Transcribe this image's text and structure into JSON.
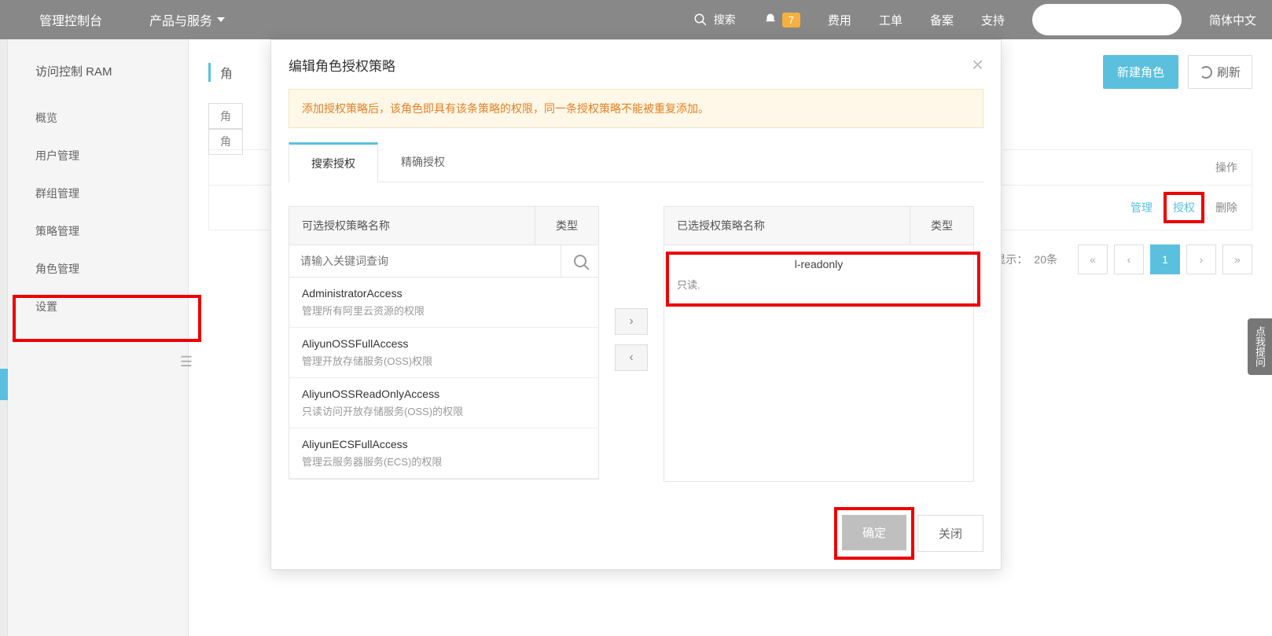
{
  "topbar": {
    "console": "管理控制台",
    "products": "产品与服务",
    "search": "搜索",
    "badge": "7",
    "links": [
      "费用",
      "工单",
      "备案",
      "支持"
    ],
    "lang": "简体中文"
  },
  "sidebar": {
    "title": "访问控制 RAM",
    "items": [
      "概览",
      "用户管理",
      "群组管理",
      "策略管理",
      "角色管理",
      "设置"
    ]
  },
  "page": {
    "title": "角",
    "new_role": "新建角色",
    "refresh": "刷新",
    "tab_stub1": "角",
    "tab_stub2": "角",
    "col_ops": "操作",
    "row_actions": {
      "manage": "管理",
      "auth": "授权",
      "delete": "删除"
    },
    "per_page_label": "页显示：",
    "per_page_value": "20条",
    "pager": {
      "first": "«",
      "prev": "‹",
      "current": "1",
      "next": "›",
      "last": "»"
    }
  },
  "modal": {
    "title": "编辑角色授权策略",
    "alert": "添加授权策略后，该角色即具有该条策略的权限，同一条授权策略不能被重复添加。",
    "tabs": {
      "search": "搜索授权",
      "exact": "精确授权"
    },
    "left": {
      "head_name": "可选授权策略名称",
      "head_type": "类型",
      "search_placeholder": "请输入关键词查询",
      "policies": [
        {
          "name": "AdministratorAccess",
          "desc": "管理所有阿里云资源的权限"
        },
        {
          "name": "AliyunOSSFullAccess",
          "desc": "管理开放存储服务(OSS)权限"
        },
        {
          "name": "AliyunOSSReadOnlyAccess",
          "desc": "只读访问开放存储服务(OSS)的权限"
        },
        {
          "name": "AliyunECSFullAccess",
          "desc": "管理云服务器服务(ECS)的权限"
        }
      ]
    },
    "right": {
      "head_name": "已选授权策略名称",
      "head_type": "类型",
      "selected": {
        "name": "l-readonly",
        "desc": "只读."
      }
    },
    "confirm": "确定",
    "close": "关闭"
  },
  "feedback": "点我提问"
}
